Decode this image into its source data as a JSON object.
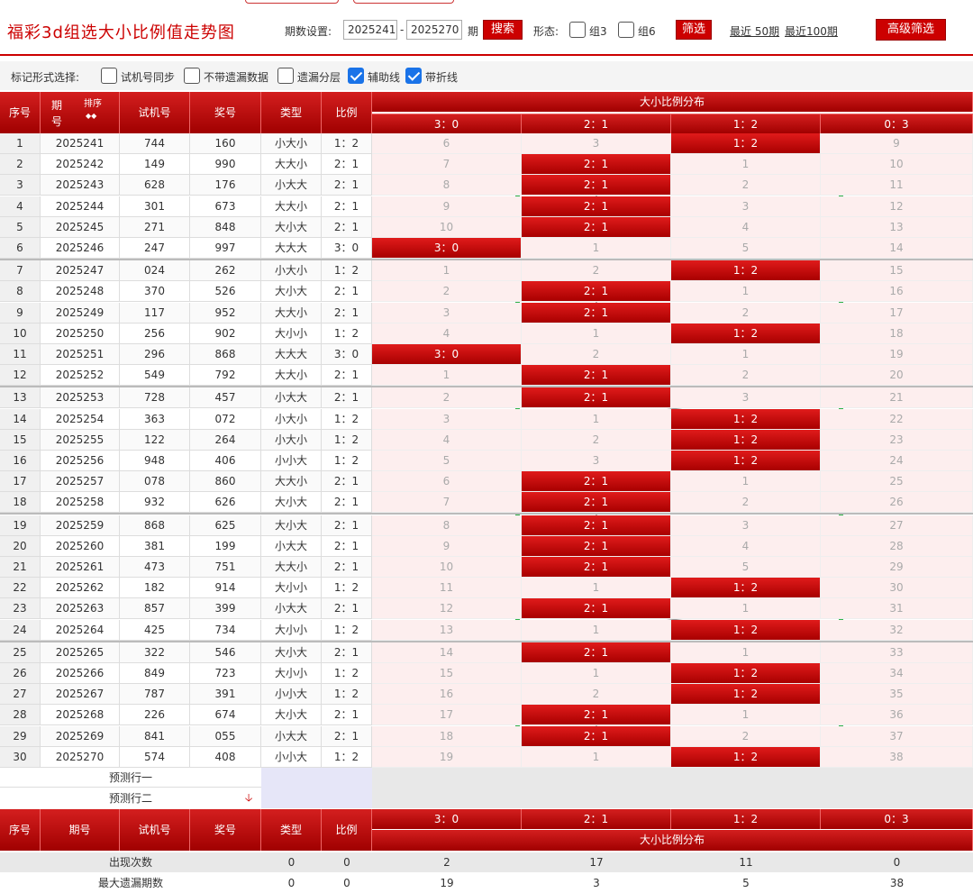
{
  "header": {
    "title": "福彩3d组选大小比例值走势图",
    "period_label": "期数设置:",
    "period_from": "2025241",
    "period_to": "2025270",
    "period_unit": "期",
    "search": "搜索",
    "form_label": "形态:",
    "group3": "组3",
    "group6": "组6",
    "filter": "筛选",
    "recent50": "最近 50期",
    "recent100": "最近100期",
    "advanced": "高级筛选"
  },
  "options": {
    "label": "标记形式选择:",
    "items": [
      {
        "label": "试机号同步",
        "checked": false
      },
      {
        "label": "不带遗漏数据",
        "checked": false
      },
      {
        "label": "遗漏分层",
        "checked": false
      },
      {
        "label": "辅助线",
        "checked": true
      },
      {
        "label": "带折线",
        "checked": true
      }
    ]
  },
  "table": {
    "headers": {
      "seq": "序号",
      "period": "期号",
      "sort": "排序",
      "trial": "试机号",
      "draw": "奖号",
      "type": "类型",
      "ratio": "比例",
      "dist": "大小比例分布"
    },
    "dist_cols": [
      "3：0",
      "2：1",
      "1：2",
      "0：3"
    ],
    "rows": [
      {
        "seq": "1",
        "period": "2025241",
        "trial": "744",
        "draw": "160",
        "type": "小大小",
        "ratio": "1：2",
        "hit": 2,
        "miss": [
          "6",
          "3",
          "",
          "9"
        ]
      },
      {
        "seq": "2",
        "period": "2025242",
        "trial": "149",
        "draw": "990",
        "type": "大大小",
        "ratio": "2：1",
        "hit": 1,
        "miss": [
          "7",
          "",
          "1",
          "10"
        ]
      },
      {
        "seq": "3",
        "period": "2025243",
        "trial": "628",
        "draw": "176",
        "type": "小大大",
        "ratio": "2：1",
        "hit": 1,
        "miss": [
          "8",
          "",
          "2",
          "11"
        ]
      },
      {
        "seq": "4",
        "period": "2025244",
        "trial": "301",
        "draw": "673",
        "type": "大大小",
        "ratio": "2：1",
        "hit": 1,
        "miss": [
          "9",
          "",
          "3",
          "12"
        ]
      },
      {
        "seq": "5",
        "period": "2025245",
        "trial": "271",
        "draw": "848",
        "type": "大小大",
        "ratio": "2：1",
        "hit": 1,
        "miss": [
          "10",
          "",
          "4",
          "13"
        ]
      },
      {
        "seq": "6",
        "period": "2025246",
        "trial": "247",
        "draw": "997",
        "type": "大大大",
        "ratio": "3：0",
        "hit": 0,
        "miss": [
          "",
          "1",
          "5",
          "14"
        ]
      },
      {
        "seq": "7",
        "period": "2025247",
        "trial": "024",
        "draw": "262",
        "type": "小大小",
        "ratio": "1：2",
        "hit": 2,
        "miss": [
          "1",
          "2",
          "",
          "15"
        ]
      },
      {
        "seq": "8",
        "period": "2025248",
        "trial": "370",
        "draw": "526",
        "type": "大小大",
        "ratio": "2：1",
        "hit": 1,
        "miss": [
          "2",
          "",
          "1",
          "16"
        ]
      },
      {
        "seq": "9",
        "period": "2025249",
        "trial": "117",
        "draw": "952",
        "type": "大大小",
        "ratio": "2：1",
        "hit": 1,
        "miss": [
          "3",
          "",
          "2",
          "17"
        ]
      },
      {
        "seq": "10",
        "period": "2025250",
        "trial": "256",
        "draw": "902",
        "type": "大小小",
        "ratio": "1：2",
        "hit": 2,
        "miss": [
          "4",
          "1",
          "",
          "18"
        ]
      },
      {
        "seq": "11",
        "period": "2025251",
        "trial": "296",
        "draw": "868",
        "type": "大大大",
        "ratio": "3：0",
        "hit": 0,
        "miss": [
          "",
          "2",
          "1",
          "19"
        ]
      },
      {
        "seq": "12",
        "period": "2025252",
        "trial": "549",
        "draw": "792",
        "type": "大大小",
        "ratio": "2：1",
        "hit": 1,
        "miss": [
          "1",
          "",
          "2",
          "20"
        ]
      },
      {
        "seq": "13",
        "period": "2025253",
        "trial": "728",
        "draw": "457",
        "type": "小大大",
        "ratio": "2：1",
        "hit": 1,
        "miss": [
          "2",
          "",
          "3",
          "21"
        ]
      },
      {
        "seq": "14",
        "period": "2025254",
        "trial": "363",
        "draw": "072",
        "type": "小大小",
        "ratio": "1：2",
        "hit": 2,
        "miss": [
          "3",
          "1",
          "",
          "22"
        ]
      },
      {
        "seq": "15",
        "period": "2025255",
        "trial": "122",
        "draw": "264",
        "type": "小大小",
        "ratio": "1：2",
        "hit": 2,
        "miss": [
          "4",
          "2",
          "",
          "23"
        ]
      },
      {
        "seq": "16",
        "period": "2025256",
        "trial": "948",
        "draw": "406",
        "type": "小小大",
        "ratio": "1：2",
        "hit": 2,
        "miss": [
          "5",
          "3",
          "",
          "24"
        ]
      },
      {
        "seq": "17",
        "period": "2025257",
        "trial": "078",
        "draw": "860",
        "type": "大大小",
        "ratio": "2：1",
        "hit": 1,
        "miss": [
          "6",
          "",
          "1",
          "25"
        ]
      },
      {
        "seq": "18",
        "period": "2025258",
        "trial": "932",
        "draw": "626",
        "type": "大小大",
        "ratio": "2：1",
        "hit": 1,
        "miss": [
          "7",
          "",
          "2",
          "26"
        ]
      },
      {
        "seq": "19",
        "period": "2025259",
        "trial": "868",
        "draw": "625",
        "type": "大小大",
        "ratio": "2：1",
        "hit": 1,
        "miss": [
          "8",
          "",
          "3",
          "27"
        ]
      },
      {
        "seq": "20",
        "period": "2025260",
        "trial": "381",
        "draw": "199",
        "type": "小大大",
        "ratio": "2：1",
        "hit": 1,
        "miss": [
          "9",
          "",
          "4",
          "28"
        ]
      },
      {
        "seq": "21",
        "period": "2025261",
        "trial": "473",
        "draw": "751",
        "type": "大大小",
        "ratio": "2：1",
        "hit": 1,
        "miss": [
          "10",
          "",
          "5",
          "29"
        ]
      },
      {
        "seq": "22",
        "period": "2025262",
        "trial": "182",
        "draw": "914",
        "type": "大小小",
        "ratio": "1：2",
        "hit": 2,
        "miss": [
          "11",
          "1",
          "",
          "30"
        ]
      },
      {
        "seq": "23",
        "period": "2025263",
        "trial": "857",
        "draw": "399",
        "type": "小大大",
        "ratio": "2：1",
        "hit": 1,
        "miss": [
          "12",
          "",
          "1",
          "31"
        ]
      },
      {
        "seq": "24",
        "period": "2025264",
        "trial": "425",
        "draw": "734",
        "type": "大小小",
        "ratio": "1：2",
        "hit": 2,
        "miss": [
          "13",
          "1",
          "",
          "32"
        ]
      },
      {
        "seq": "25",
        "period": "2025265",
        "trial": "322",
        "draw": "546",
        "type": "大小大",
        "ratio": "2：1",
        "hit": 1,
        "miss": [
          "14",
          "",
          "1",
          "33"
        ]
      },
      {
        "seq": "26",
        "period": "2025266",
        "trial": "849",
        "draw": "723",
        "type": "大小小",
        "ratio": "1：2",
        "hit": 2,
        "miss": [
          "15",
          "1",
          "",
          "34"
        ]
      },
      {
        "seq": "27",
        "period": "2025267",
        "trial": "787",
        "draw": "391",
        "type": "小小大",
        "ratio": "1：2",
        "hit": 2,
        "miss": [
          "16",
          "2",
          "",
          "35"
        ]
      },
      {
        "seq": "28",
        "period": "2025268",
        "trial": "226",
        "draw": "674",
        "type": "大小大",
        "ratio": "2：1",
        "hit": 1,
        "miss": [
          "17",
          "",
          "1",
          "36"
        ]
      },
      {
        "seq": "29",
        "period": "2025269",
        "trial": "841",
        "draw": "055",
        "type": "小大大",
        "ratio": "2：1",
        "hit": 1,
        "miss": [
          "18",
          "",
          "2",
          "37"
        ]
      },
      {
        "seq": "30",
        "period": "2025270",
        "trial": "574",
        "draw": "408",
        "type": "小小大",
        "ratio": "1：2",
        "hit": 2,
        "miss": [
          "19",
          "1",
          "",
          "38"
        ]
      }
    ],
    "predict1": "预测行一",
    "predict2": "预测行二",
    "stats": [
      {
        "label": "出现次数",
        "type": "0",
        "ratio": "0",
        "vals": [
          "2",
          "17",
          "11",
          "0"
        ]
      },
      {
        "label": "最大遗漏期数",
        "type": "0",
        "ratio": "0",
        "vals": [
          "19",
          "3",
          "5",
          "38"
        ]
      }
    ]
  }
}
